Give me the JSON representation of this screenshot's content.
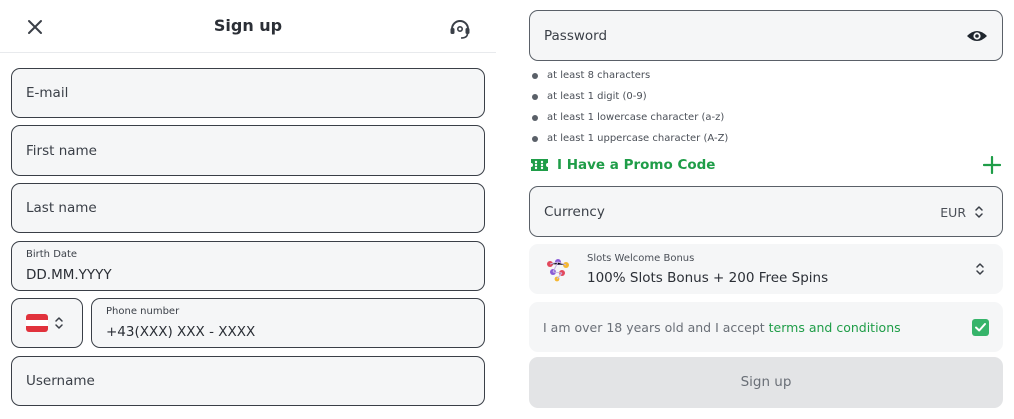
{
  "header": {
    "title": "Sign up"
  },
  "form": {
    "email": {
      "placeholder": "E-mail"
    },
    "first_name": {
      "placeholder": "First name"
    },
    "last_name": {
      "placeholder": "Last name"
    },
    "birth_date": {
      "label": "Birth Date",
      "value": "DD.MM.YYYY"
    },
    "country": {
      "flag": "Austria",
      "colors": [
        "#e1323c",
        "#ffffff",
        "#e1323c"
      ]
    },
    "phone": {
      "label": "Phone number",
      "value": "+43(XXX) XXX - XXXX"
    },
    "username": {
      "placeholder": "Username"
    },
    "password": {
      "placeholder": "Password"
    },
    "password_rules": [
      "at least 8 characters",
      "at least 1 digit (0-9)",
      "at least 1 lowercase character (a-z)",
      "at least 1 uppercase character (A-Z)"
    ],
    "promo": {
      "label": "I Have a Promo Code"
    },
    "currency": {
      "label": "Currency",
      "value": "EUR"
    },
    "bonus": {
      "label": "Slots Welcome Bonus",
      "value": "100% Slots Bonus + 200 Free Spins"
    },
    "terms": {
      "text": "I am over 18 years old and I accept ",
      "link": "terms and conditions",
      "checked": true
    },
    "submit_label": "Sign up"
  },
  "colors": {
    "accent_green": "#1f9d48",
    "checkbox_green": "#36b46a",
    "field_bg": "#f5f6f7",
    "button_disabled_bg": "#e3e4e6"
  },
  "icons": [
    "close-icon",
    "headset-icon",
    "eye-icon",
    "ticket-icon",
    "plus-icon",
    "chevron-updown-icon",
    "slots-bonus-icon",
    "check-icon"
  ]
}
